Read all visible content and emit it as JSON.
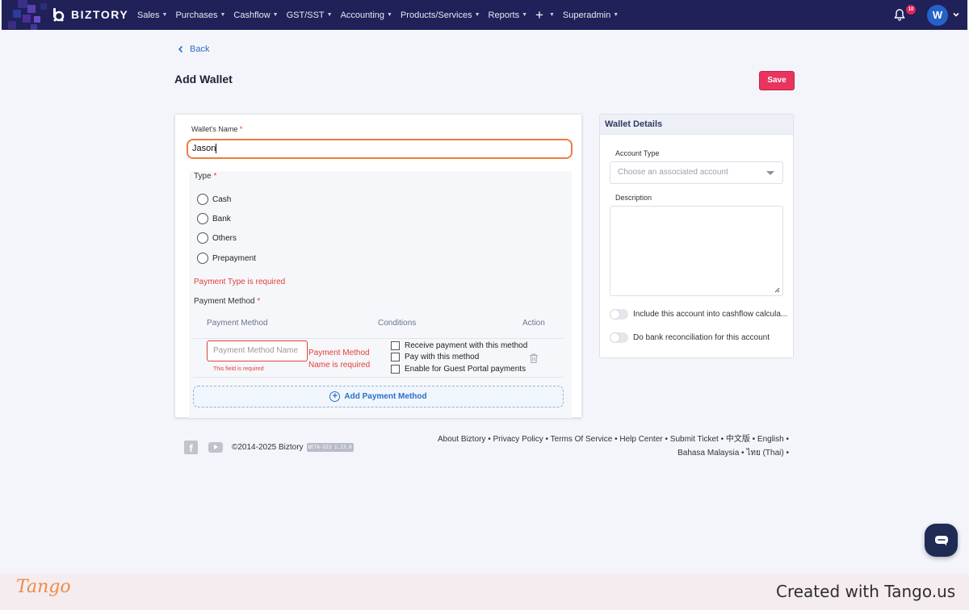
{
  "nav": {
    "brand": "BIZTORY",
    "menu": [
      "Sales",
      "Purchases",
      "Cashflow",
      "GST/SST",
      "Accounting",
      "Products/Services",
      "Reports",
      "+",
      "Superadmin"
    ],
    "notification_count": "10",
    "avatar_letter": "W"
  },
  "page": {
    "back_label": "Back",
    "title": "Add Wallet",
    "save_label": "Save"
  },
  "form": {
    "wallet_name_label": "Wallet's Name",
    "wallet_name_value": "Jason",
    "type_label": "Type",
    "type_options": [
      "Cash",
      "Bank",
      "Others",
      "Prepayment"
    ],
    "type_error": "Payment Type is required",
    "payment_method_label": "Payment Method",
    "table_headers": {
      "method": "Payment Method",
      "conditions": "Conditions",
      "action": "Action"
    },
    "method_placeholder": "Payment Method Name",
    "field_required": "This field is required",
    "method_error": "Payment Method Name is required",
    "conditions": [
      "Receive payment with this method",
      "Pay with this method",
      "Enable for Guest Portal payments"
    ],
    "add_method_label": "Add Payment Method"
  },
  "wallet_details": {
    "title": "Wallet Details",
    "account_type_label": "Account Type",
    "account_type_placeholder": "Choose an associated account",
    "description_label": "Description",
    "toggles": [
      "Include this account into cashflow calcula...",
      "Do bank reconciliation for this account"
    ]
  },
  "footer": {
    "copyright": "©2014-2025 Biztory",
    "version": "BETA-SI3 1.13.0",
    "links_line1": "About Biztory • Privacy Policy • Terms Of Service • Help Center • Submit Ticket • 中文版 • English •",
    "links_line2": "Bahasa Malaysia • ไทย (Thai) •"
  },
  "watermark": {
    "logo": "Tango",
    "credit": "Created with Tango.us"
  },
  "colors": {
    "nav_bg": "#1f2158",
    "accent_save": "#e8345e",
    "focus_border": "#f07a46",
    "link": "#2a6fc9",
    "error": "#e0413a"
  }
}
